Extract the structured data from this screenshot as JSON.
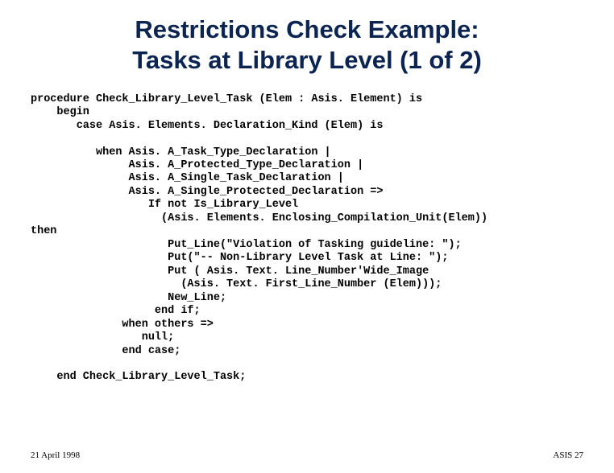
{
  "title_line1": "Restrictions Check Example:",
  "title_line2": "Tasks at Library Level (1 of 2)",
  "code": "procedure Check_Library_Level_Task (Elem : Asis. Element) is\n    begin\n       case Asis. Elements. Declaration_Kind (Elem) is\n\n          when Asis. A_Task_Type_Declaration |\n               Asis. A_Protected_Type_Declaration |\n               Asis. A_Single_Task_Declaration |\n               Asis. A_Single_Protected_Declaration =>\n                  If not Is_Library_Level\n                    (Asis. Elements. Enclosing_Compilation_Unit(Elem))\nthen\n                     Put_Line(\"Violation of Tasking guideline: \");\n                     Put(\"-- Non-Library Level Task at Line: \");\n                     Put ( Asis. Text. Line_Number'Wide_Image\n                       (Asis. Text. First_Line_Number (Elem)));\n                     New_Line;\n                   end if;\n              when others =>\n                 null;\n              end case;\n\n    end Check_Library_Level_Task;",
  "footer_left": "21 April 1998",
  "footer_right": "ASIS 27"
}
